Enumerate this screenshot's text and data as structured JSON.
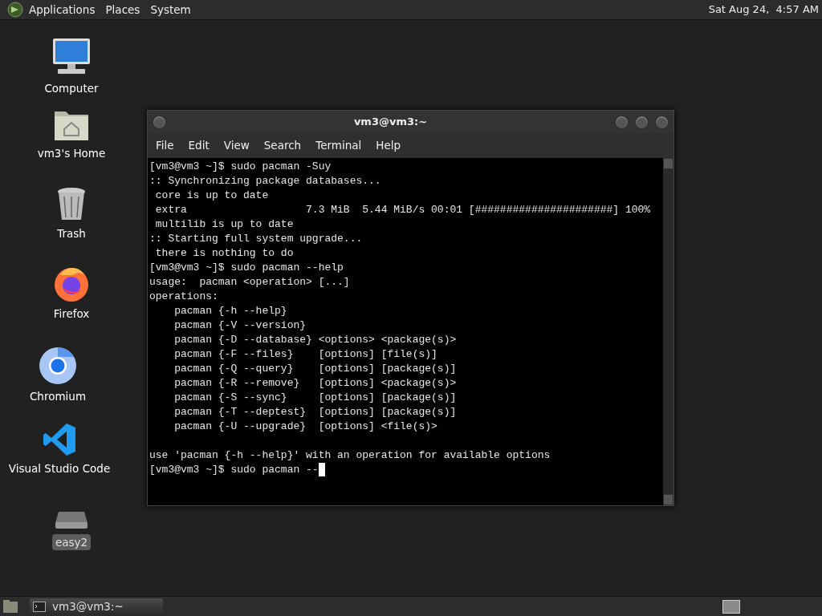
{
  "top_panel": {
    "menus": [
      "Applications",
      "Places",
      "System"
    ],
    "clock": "Sat Aug 24,  4:57 AM"
  },
  "desktop_icons": [
    {
      "kind": "computer",
      "label": "Computer",
      "selected": false
    },
    {
      "kind": "home",
      "label": "vm3's Home",
      "selected": false
    },
    {
      "kind": "trash",
      "label": "Trash",
      "selected": false
    },
    {
      "kind": "firefox",
      "label": "Firefox",
      "selected": false
    },
    {
      "kind": "chromium",
      "label": "Chromium",
      "selected": false
    },
    {
      "kind": "vscode",
      "label": "Visual Studio Code",
      "selected": false
    },
    {
      "kind": "drive",
      "label": "easy2",
      "selected": true
    }
  ],
  "window": {
    "title": "vm3@vm3:~",
    "menu": [
      "File",
      "Edit",
      "View",
      "Search",
      "Terminal",
      "Help"
    ],
    "terminal_blocks": [
      [
        "[vm3@vm3 ~]$ sudo pacman -Suy",
        ":: Synchronizing package databases...",
        " core is up to date",
        " extra                   7.3 MiB  5.44 MiB/s 00:01 [######################] 100%",
        " multilib is up to date",
        ":: Starting full system upgrade...",
        " there is nothing to do",
        "[vm3@vm3 ~]$ sudo pacman --help",
        "usage:  pacman <operation> [...]",
        "operations:",
        "    pacman {-h --help}",
        "    pacman {-V --version}",
        "    pacman {-D --database} <options> <package(s)>",
        "    pacman {-F --files}    [options] [file(s)]",
        "    pacman {-Q --query}    [options] [package(s)]",
        "    pacman {-R --remove}   [options] <package(s)>",
        "    pacman {-S --sync}     [options] [package(s)]",
        "    pacman {-T --deptest}  [options] [package(s)]",
        "    pacman {-U --upgrade}  [options] <file(s)>"
      ],
      [
        "use 'pacman {-h --help}' with an operation for available options",
        "[vm3@vm3 ~]$ sudo pacman --"
      ]
    ],
    "cursor_visible": true
  },
  "taskbar": {
    "tasks": [
      {
        "label": "vm3@vm3:~",
        "selected": false
      }
    ]
  }
}
